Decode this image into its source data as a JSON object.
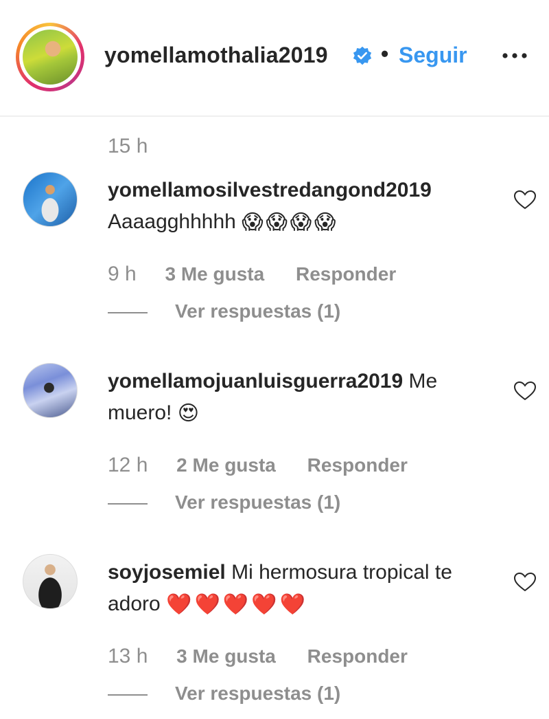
{
  "header": {
    "username": "yomellamothalia2019",
    "separator": "•",
    "follow_label": "Seguir",
    "verified_icon": "verified-badge-icon",
    "more_icon": "more-options-icon",
    "ring_colors": [
      "#f9c33c",
      "#e1306c",
      "#c13584"
    ]
  },
  "post_time": "15 h",
  "comments": [
    {
      "username": "yomellamosilvestredangond2019",
      "text": "Aaaagghhhhh",
      "emoji": [
        "😱",
        "😱",
        "😱",
        "😱"
      ],
      "time": "9 h",
      "likes": "3 Me gusta",
      "reply_label": "Responder",
      "view_replies": "Ver respuestas (1)"
    },
    {
      "username": "yomellamojuanluisguerra2019",
      "text": "Me muero!",
      "emoji": [
        "😍"
      ],
      "time": "12 h",
      "likes": "2 Me gusta",
      "reply_label": "Responder",
      "view_replies": "Ver respuestas (1)"
    },
    {
      "username": "soyjosemiel",
      "text": "Mi hermosura tropical te adoro",
      "emoji": [
        "❤️",
        "❤️",
        "❤️",
        "❤️",
        "❤️"
      ],
      "time": "13 h",
      "likes": "3 Me gusta",
      "reply_label": "Responder",
      "view_replies": "Ver respuestas (1)"
    }
  ],
  "colors": {
    "link_blue": "#3897f0",
    "text_primary": "#262626",
    "text_secondary": "#8e8e8e",
    "divider": "#efefef"
  }
}
